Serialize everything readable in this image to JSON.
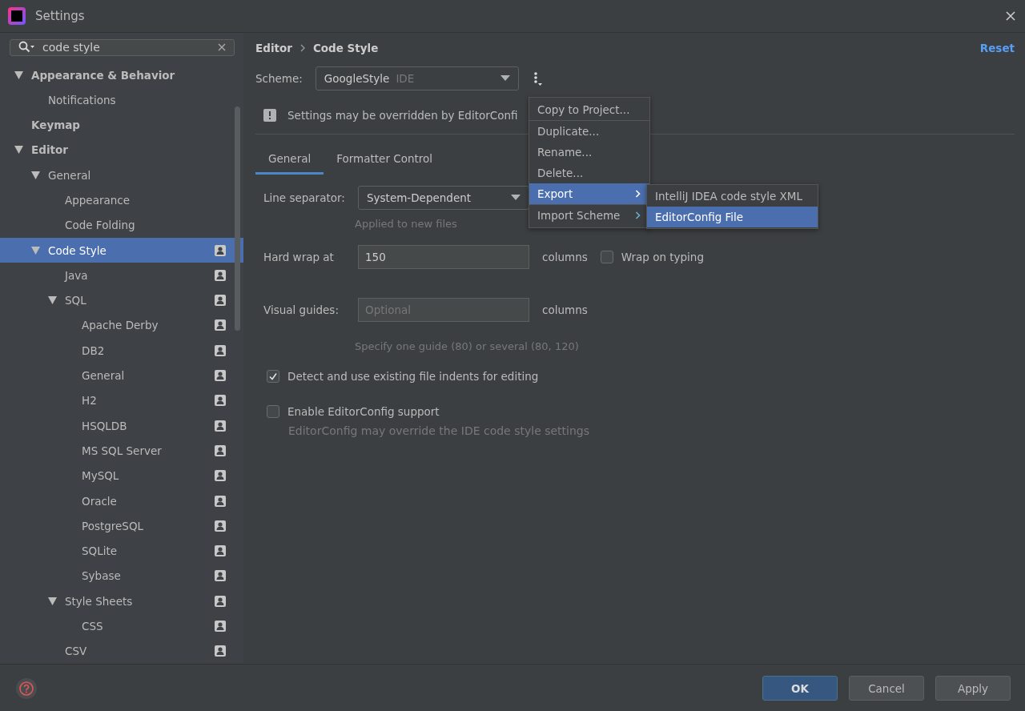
{
  "window": {
    "title": "Settings"
  },
  "search": {
    "value": "code style"
  },
  "tree": [
    {
      "label": "Appearance & Behavior",
      "expanded": true,
      "selected": false,
      "scoped": false,
      "children": [
        {
          "label": "Notifications",
          "selected": false,
          "scoped": false
        }
      ]
    },
    {
      "label": "Keymap",
      "selected": false,
      "scoped": false
    },
    {
      "label": "Editor",
      "expanded": true,
      "selected": false,
      "scoped": false,
      "children": [
        {
          "label": "General",
          "expanded": true,
          "selected": false,
          "scoped": false,
          "children": [
            {
              "label": "Appearance",
              "selected": false,
              "scoped": false
            },
            {
              "label": "Code Folding",
              "selected": false,
              "scoped": false
            }
          ]
        },
        {
          "label": "Code Style",
          "expanded": true,
          "selected": true,
          "scoped": true,
          "children": [
            {
              "label": "Java",
              "selected": false,
              "scoped": true
            },
            {
              "label": "SQL",
              "expanded": true,
              "selected": false,
              "scoped": true,
              "children": [
                {
                  "label": "Apache Derby",
                  "selected": false,
                  "scoped": true
                },
                {
                  "label": "DB2",
                  "selected": false,
                  "scoped": true
                },
                {
                  "label": "General",
                  "selected": false,
                  "scoped": true
                },
                {
                  "label": "H2",
                  "selected": false,
                  "scoped": true
                },
                {
                  "label": "HSQLDB",
                  "selected": false,
                  "scoped": true
                },
                {
                  "label": "MS SQL Server",
                  "selected": false,
                  "scoped": true
                },
                {
                  "label": "MySQL",
                  "selected": false,
                  "scoped": true
                },
                {
                  "label": "Oracle",
                  "selected": false,
                  "scoped": true
                },
                {
                  "label": "PostgreSQL",
                  "selected": false,
                  "scoped": true
                },
                {
                  "label": "SQLite",
                  "selected": false,
                  "scoped": true
                },
                {
                  "label": "Sybase",
                  "selected": false,
                  "scoped": true
                }
              ]
            },
            {
              "label": "Style Sheets",
              "expanded": true,
              "selected": false,
              "scoped": true,
              "children": [
                {
                  "label": "CSS",
                  "selected": false,
                  "scoped": true
                }
              ]
            },
            {
              "label": "CSV",
              "selected": false,
              "scoped": true
            }
          ]
        }
      ]
    }
  ],
  "breadcrumb": [
    "Editor",
    "Code Style"
  ],
  "reset": "Reset",
  "scheme": {
    "label": "Scheme:",
    "value": "GoogleStyle",
    "tag": "IDE"
  },
  "notice": "Settings may be overridden by EditorConfi",
  "tabs": [
    {
      "label": "General",
      "selected": true
    },
    {
      "label": "Formatter Control",
      "selected": false
    }
  ],
  "line_separator": {
    "label": "Line separator:",
    "value": "System-Dependent",
    "hint": "Applied to new files"
  },
  "hard_wrap": {
    "label": "Hard wrap at",
    "value": "150",
    "unit": "columns",
    "wrap_label": "Wrap on typing",
    "wrap_checked": false
  },
  "visual_guides": {
    "label": "Visual guides:",
    "placeholder": "Optional",
    "unit": "columns",
    "hint": "Specify one guide (80) or several (80, 120)"
  },
  "options": [
    {
      "label": "Detect and use existing file indents for editing",
      "checked": true
    },
    {
      "label": "Enable EditorConfig support",
      "checked": false,
      "hint": "EditorConfig may override the IDE code style settings"
    }
  ],
  "menu": [
    {
      "label": "Copy to Project...",
      "selected": false,
      "submenu": false,
      "separator_after": true
    },
    {
      "label": "Duplicate...",
      "selected": false,
      "submenu": false,
      "separator_after": false
    },
    {
      "label": "Rename...",
      "selected": false,
      "submenu": false,
      "separator_after": false
    },
    {
      "label": "Delete...",
      "selected": false,
      "submenu": false,
      "separator_after": false
    },
    {
      "label": "Export",
      "selected": true,
      "submenu": true,
      "separator_after": true
    },
    {
      "label": "Import Scheme",
      "selected": false,
      "submenu": true,
      "separator_after": false
    }
  ],
  "submenu": [
    {
      "label": "IntelliJ IDEA code style XML",
      "selected": false
    },
    {
      "label": "EditorConfig File",
      "selected": true
    }
  ],
  "buttons": [
    {
      "label": "OK",
      "kind": "primary"
    },
    {
      "label": "Cancel",
      "kind": "normal"
    },
    {
      "label": "Apply",
      "kind": "normal"
    }
  ]
}
